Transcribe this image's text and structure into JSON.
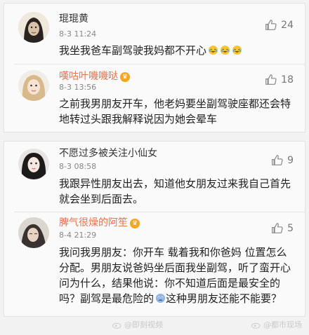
{
  "comments": [
    {
      "name": "琨琨黄",
      "vip": false,
      "time": "8-3 11:24",
      "likes": "24",
      "text": "我坐我爸车副驾驶我妈都不开心",
      "emoji": [
        "laugh-cry-emoji",
        "laugh-cry-emoji",
        "laugh-cry-emoji"
      ]
    },
    {
      "name": "嘆咕叶嘰嘰哒",
      "vip": true,
      "time": "8-3 13:56",
      "likes": "18",
      "text": "之前我男朋友开车，他老妈要坐副驾驶座都还会特地转过头跟我解释说因为她会晕车"
    },
    {
      "name": "不愿过多被关注小仙女",
      "vip": false,
      "time": "8-3 08:58",
      "likes": "9",
      "text": "我跟异性朋友出去，知道他女朋友过来我自己首先就会坐到后面去。"
    },
    {
      "name": "脾气很燥的阿笙",
      "vip": true,
      "time": "8-4 21:29",
      "likes": "5",
      "text_before": "我问我男朋友：你开车 载着我和你爸妈 位置怎么分配。男朋友说爸妈坐后面我坐副驾，听了蛮开心问为什么，结果他说：你不知道后面是最安全的吗？副驾是最危险的",
      "text_after": "这种男朋友还能不能要？"
    }
  ],
  "watermarks": [
    "@即刻视频",
    "@都市现场"
  ],
  "colors": {
    "vip_name": "#eb7350",
    "text": "#222222",
    "meta": "#888888"
  }
}
